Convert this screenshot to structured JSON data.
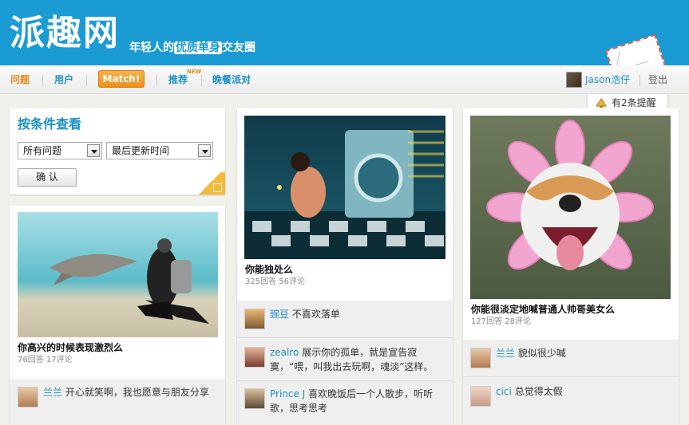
{
  "header": {
    "logo": "派趣网",
    "tagline_pre": "年轻人的",
    "tagline_highlight": "优质单身",
    "tagline_post": "交友圈"
  },
  "nav": {
    "items": [
      "问题",
      "用户",
      "推荐",
      "晚餐派对"
    ],
    "match_label": "Match!",
    "new_badge": "NEW",
    "user_name": "Jason浩仔",
    "logout": "登出"
  },
  "notification": {
    "text": "有2条提醒"
  },
  "filter": {
    "title": "按条件查看",
    "select1": "所有问题",
    "select2": "最后更新时间",
    "confirm": "确 认"
  },
  "posts": [
    {
      "title": "你高兴的时候表现激烈么",
      "stats": "76回答 17评论",
      "comments": [
        {
          "name": "兰兰",
          "text": "开心就笑啊，我也愿意与朋友分享"
        }
      ]
    },
    {
      "title": "你能独处么",
      "stats": "325回答 56评论",
      "comments": [
        {
          "name": "豌豆",
          "text": "不喜欢落单"
        },
        {
          "name": "zealro",
          "text": "展示你的孤单，就是宣告寂",
          "text2": "寞，“喂，叫我出去玩啊，魂淡”这样。"
        },
        {
          "name": "Prince J",
          "text": "喜欢晚饭后一个人散步，听听",
          "text2": "歌，思考思考"
        }
      ]
    },
    {
      "title": "你能很淡定地喊普通人帅哥美女么",
      "stats": "127回答 28评论",
      "comments": [
        {
          "name": "兰兰",
          "text": "貌似很少喊"
        },
        {
          "name": "cici",
          "text": "总觉得太假"
        }
      ]
    }
  ],
  "colors": {
    "brand": "#1a9bd3",
    "accent": "#ee8f1a",
    "link": "#1a8fc8"
  }
}
